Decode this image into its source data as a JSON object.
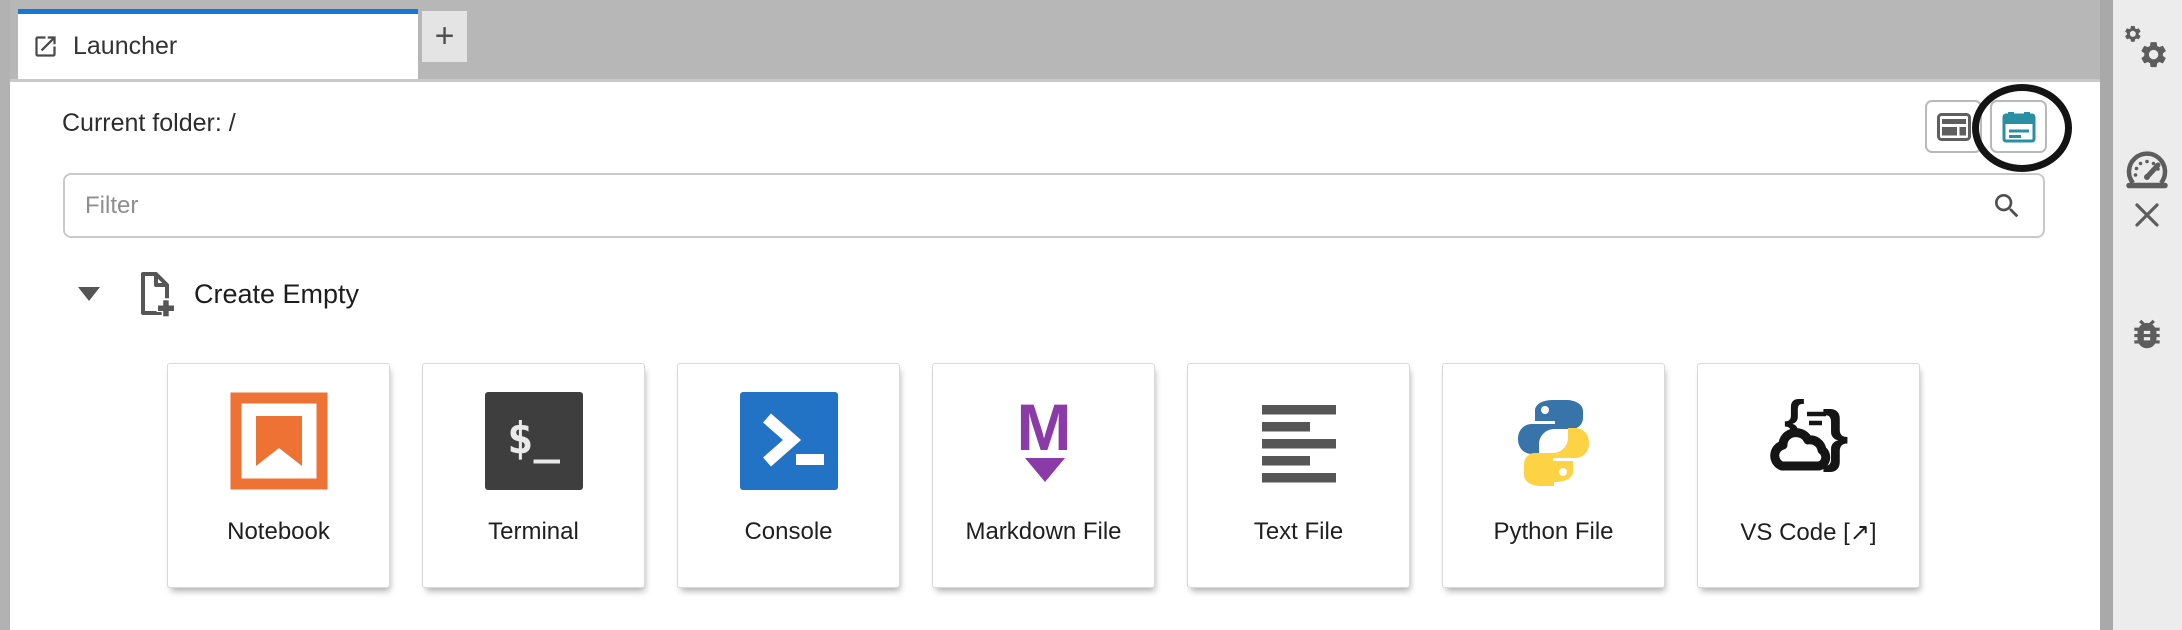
{
  "tab_bar": {
    "active_tab_label": "Launcher",
    "new_tab_button": "+"
  },
  "toolbar": {
    "current_folder_label": "Current folder: /",
    "filter_placeholder": "Filter",
    "view_toggle": {
      "left_button_icon": "table-view-icon",
      "right_button_icon": "card-view-icon",
      "annotation": "black circle highlighting card-view button"
    }
  },
  "launcher": {
    "section_title": "Create Empty",
    "cards": [
      {
        "label": "Notebook"
      },
      {
        "label": "Terminal"
      },
      {
        "label": "Console"
      },
      {
        "label": "Markdown File"
      },
      {
        "label": "Text File"
      },
      {
        "label": "Python File"
      },
      {
        "label": "VS Code [↗]"
      }
    ]
  },
  "icon_glyphs": {
    "terminal": "$_",
    "markdown": "M",
    "vscode_brace_left": "{",
    "vscode_brace_right": "}"
  },
  "right_sidebar": {
    "icons": [
      "settings-gears",
      "performance-gauge",
      "close",
      "debugger-bug"
    ]
  },
  "colors": {
    "tab_accent_blue": "#1976d2",
    "tabbar_gray": "#b7b7b7",
    "notebook_orange": "#ee7233",
    "terminal_dark": "#3e3e3e",
    "console_blue": "#2272c6",
    "markdown_purple": "#8a3ba8",
    "python_blue": "#3873a9",
    "python_yellow": "#fdd345",
    "text_file_gray": "#565656",
    "card_view_teal": "#2b8fa3",
    "sidebar_bg": "#ececec",
    "icon_gray": "#5d5d5d"
  }
}
